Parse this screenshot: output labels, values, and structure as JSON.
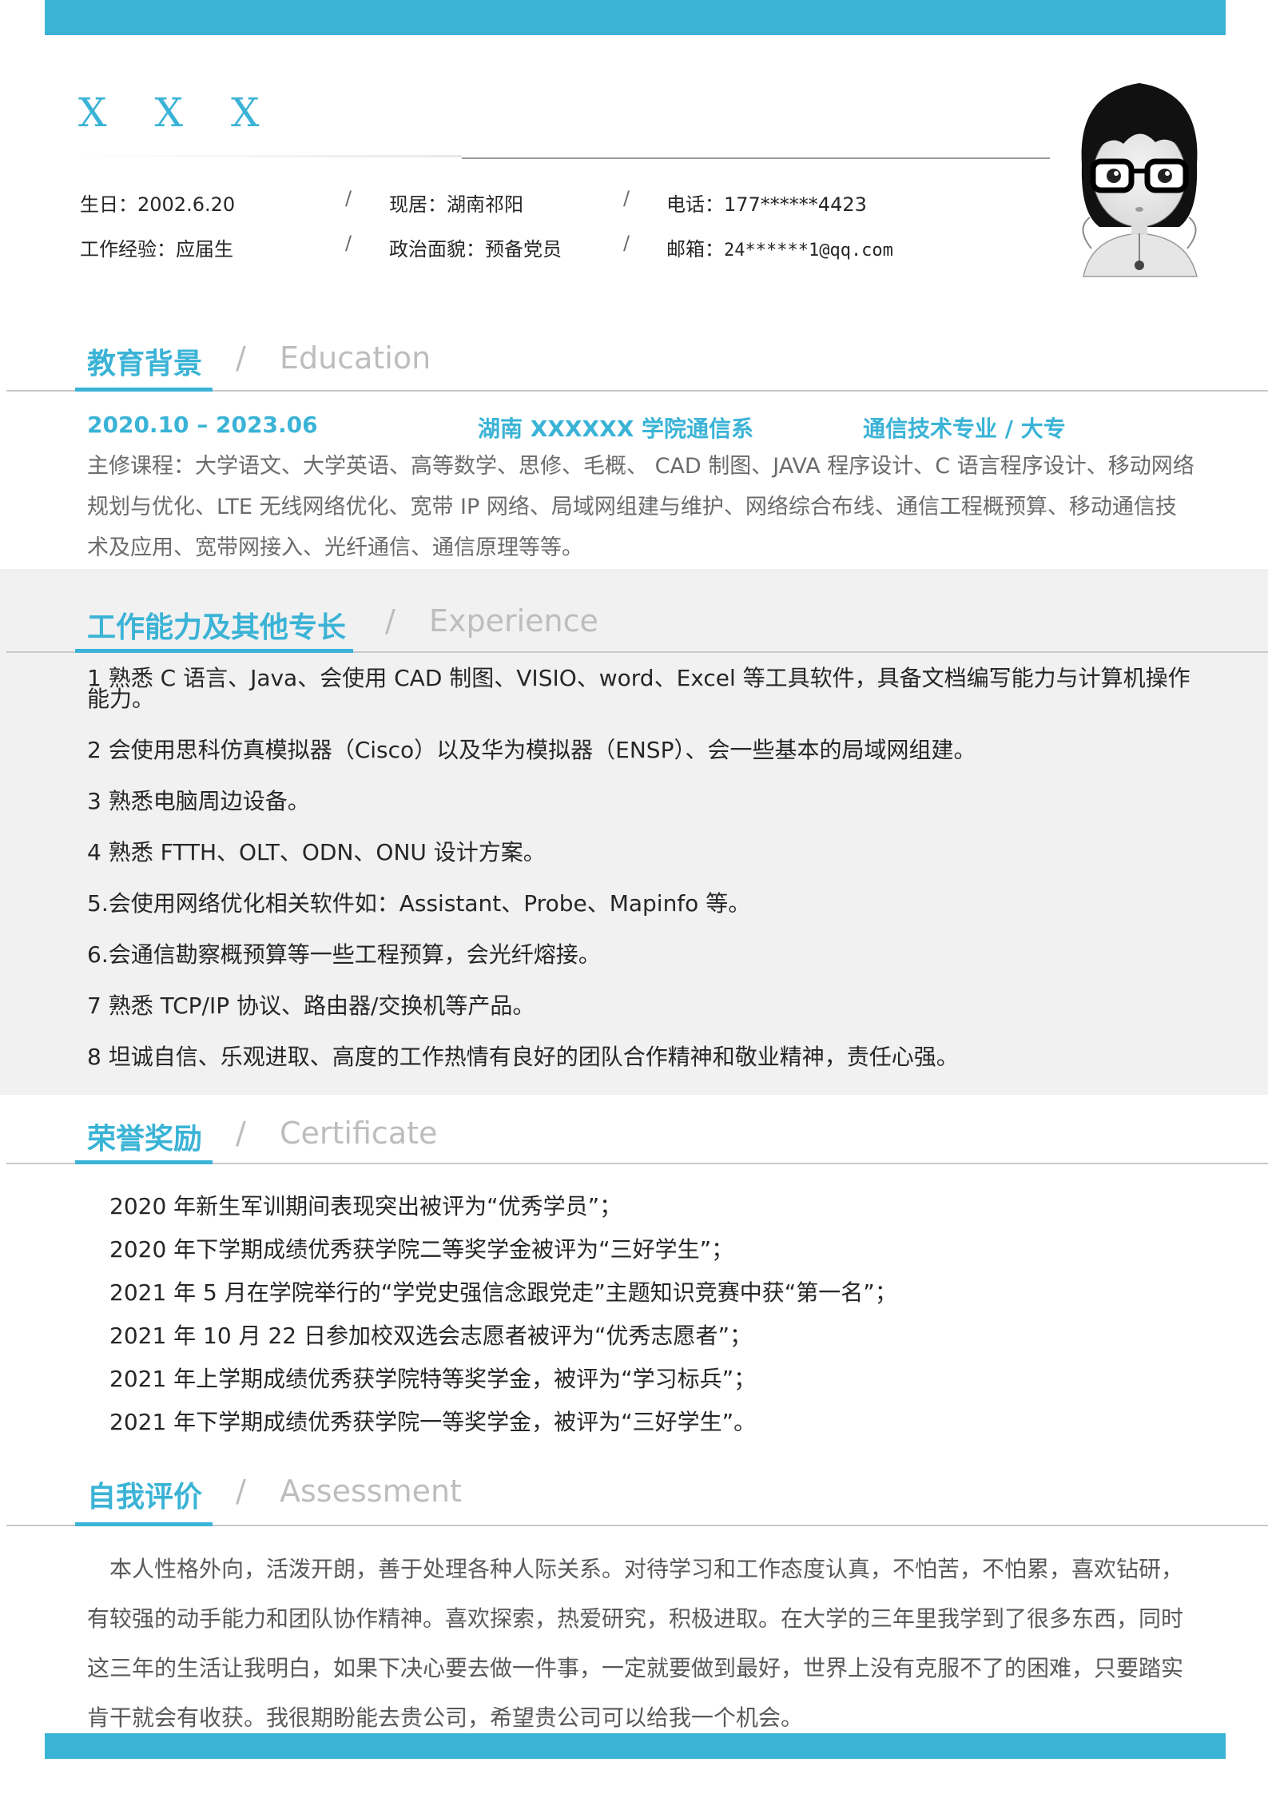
{
  "header": {
    "name": "X X X",
    "info_row1": [
      {
        "label": "生日：",
        "value": "2002.6.20"
      },
      {
        "label": "现居：",
        "value": "湖南祁阳"
      },
      {
        "label": "电话：",
        "value": "177******4423"
      }
    ],
    "info_row2": [
      {
        "label": "工作经验：",
        "value": "应届生"
      },
      {
        "label": "政治面貌：",
        "value": "预备党员"
      },
      {
        "label": "邮箱：",
        "value": "24******1@qq.com"
      }
    ],
    "separator": "/"
  },
  "colors": {
    "accent": "#3ab3d6",
    "band_bg": "#f1f1f1"
  },
  "sections": {
    "education": {
      "title_zh": "教育背景",
      "title_en": "Education",
      "period": "2020.10 – 2023.06",
      "school": "湖南 XXXXXX 学院通信系",
      "major": "通信技术专业 / 大专",
      "courses": "主修课程：大学语文、大学英语、高等数学、思修、毛概、 CAD 制图、JAVA 程序设计、C 语言程序设计、移动网络规划与优化、LTE 无线网络优化、宽带 IP 网络、局域网组建与维护、网络综合布线、通信工程概预算、移动通信技术及应用、宽带网接入、光纤通信、通信原理等等。"
    },
    "experience": {
      "title_zh": "工作能力及其他专长",
      "title_en": "Experience",
      "items": [
        "1 熟悉 C 语言、Java、会使用 CAD 制图、VISIO、word、Excel 等工具软件，具备文档编写能力与计算机操作能力。",
        "2 会使用思科仿真模拟器（Cisco）以及华为模拟器（ENSP）、会一些基本的局域网组建。",
        "3 熟悉电脑周边设备。",
        "4 熟悉 FTTH、OLT、ODN、ONU 设计方案。",
        "5.会使用网络优化相关软件如：Assistant、Probe、Mapinfo 等。",
        "6.会通信勘察概预算等一些工程预算，会光纤熔接。",
        "7 熟悉 TCP/IP 协议、路由器/交换机等产品。",
        "8 坦诚自信、乐观进取、高度的工作热情有良好的团队合作精神和敬业精神，责任心强。"
      ]
    },
    "certificate": {
      "title_zh": "荣誉奖励",
      "title_en": "Certificate",
      "items": [
        "2020 年新生军训期间表现突出被评为“优秀学员”；",
        "2020 年下学期成绩优秀获学院二等奖学金被评为“三好学生”；",
        "2021 年 5 月在学院举行的“学党史强信念跟党走”主题知识竞赛中获“第一名”；",
        "2021 年 10 月 22 日参加校双选会志愿者被评为“优秀志愿者”；",
        "2021 年上学期成绩优秀获学院特等奖学金，被评为“学习标兵”；",
        "2021 年下学期成绩优秀获学院一等奖学金，被评为“三好学生”。"
      ]
    },
    "assessment": {
      "title_zh": "自我评价",
      "title_en": "Assessment",
      "text": "本人性格外向，活泼开朗，善于处理各种人际关系。对待学习和工作态度认真，不怕苦，不怕累，喜欢钻研，有较强的动手能力和团队协作精神。喜欢探索，热爱研究，积极进取。在大学的三年里我学到了很多东西，同时这三年的生活让我明白，如果下决心要去做一件事，一定就要做到最好，世界上没有克服不了的困难，只要踏实肯干就会有收获。我很期盼能去贵公司，希望贵公司可以给我一个机会。"
    }
  }
}
